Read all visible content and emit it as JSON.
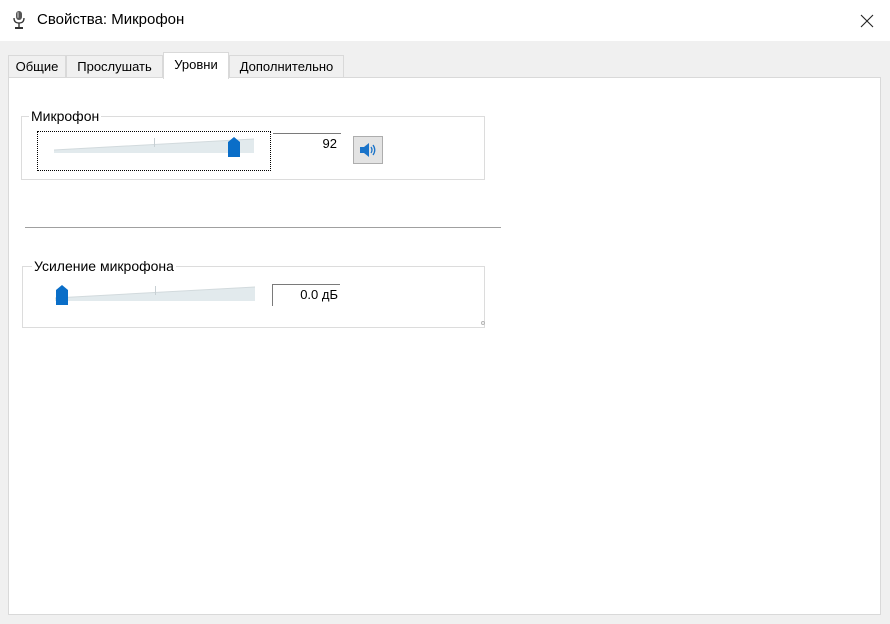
{
  "window": {
    "title": "Свойства: Микрофон",
    "app_icon": "microphone-icon",
    "close_icon": "close-icon"
  },
  "tabs": [
    {
      "label": "Общие",
      "active": false
    },
    {
      "label": "Прослушать",
      "active": false
    },
    {
      "label": "Уровни",
      "active": true
    },
    {
      "label": "Дополнительно",
      "active": false
    }
  ],
  "levels": {
    "microphone": {
      "label": "Микрофон",
      "value": "92",
      "slider_fraction": 0.92,
      "mute_icon": "speaker-icon"
    },
    "boost": {
      "label": "Усиление микрофона",
      "value": "0.0 дБ",
      "slider_fraction": 0.0
    }
  },
  "colors": {
    "thumb": "#0a6ec8",
    "panel": "#ffffff",
    "chrome": "#f0f0f0"
  }
}
